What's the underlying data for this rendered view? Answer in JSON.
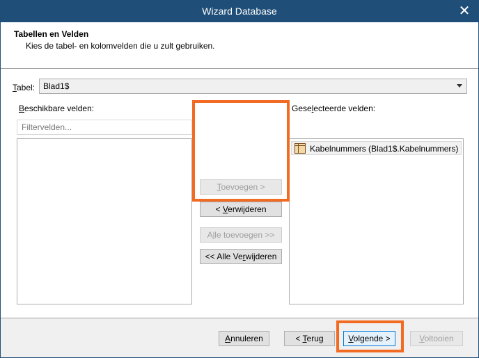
{
  "window": {
    "title": "Wizard Database",
    "close_icon": "close-icon",
    "title_color": "#1f4e79"
  },
  "header": {
    "title": "Tabellen en Velden",
    "subtitle": "Kies de tabel- en kolomvelden die u zult gebruiken."
  },
  "tabel": {
    "label_mnemonic": "T",
    "label_rest": "abel:",
    "value": "Blad1$"
  },
  "available": {
    "label_mnemonic": "B",
    "label_rest": "eschikbare velden:",
    "filter_placeholder": "Filtervelden...",
    "items": []
  },
  "selected": {
    "label_pre": "Gese",
    "label_mnemonic": "l",
    "label_post": "ecteerde velden:",
    "items": [
      {
        "label": "Kabelnummers (Blad1$.Kabelnummers)",
        "icon": "table-field-icon"
      }
    ]
  },
  "buttons": {
    "add": {
      "mnemonic": "T",
      "rest": "oevoegen >"
    },
    "remove": {
      "pre": "< ",
      "mnemonic": "V",
      "rest": "erwijderen"
    },
    "add_all": {
      "pre": "A",
      "mnemonic": "l",
      "rest": "le toevoegen >>"
    },
    "remove_all": {
      "pre": "<< Alle Ve",
      "mnemonic": "r",
      "rest": "wijderen"
    }
  },
  "footer": {
    "cancel": {
      "mnemonic": "A",
      "rest": "nnuleren"
    },
    "back": {
      "pre": "< ",
      "mnemonic": "T",
      "rest": "erug"
    },
    "next": {
      "mnemonic": "V",
      "rest": "olgende >"
    },
    "finish": {
      "mnemonic": "V",
      "rest": "oltooien"
    }
  },
  "highlight_color": "#f26b22"
}
